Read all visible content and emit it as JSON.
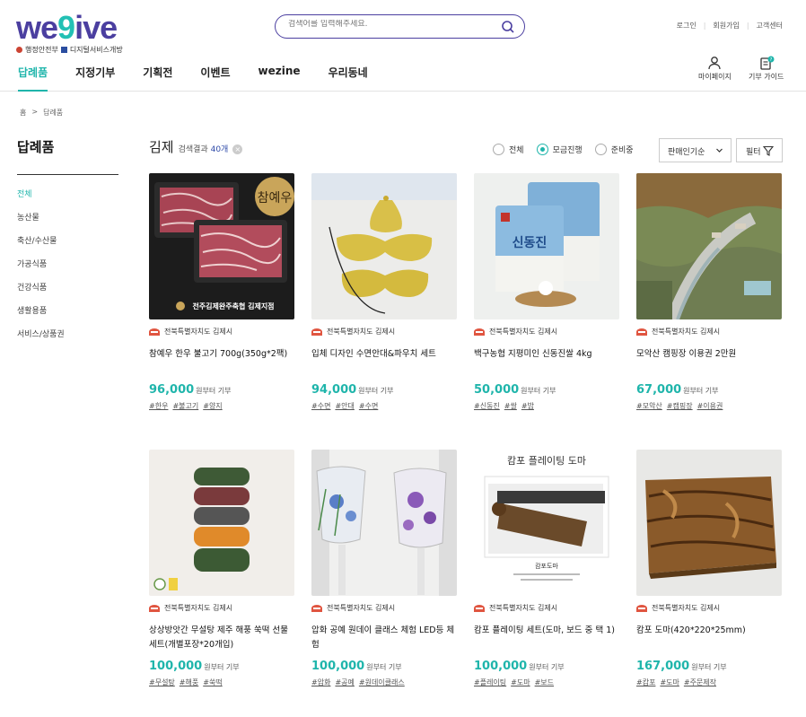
{
  "header": {
    "logo_main": "we",
    "logo_mid": "9",
    "logo_tail": "ive",
    "logo_org1": "행정안전부",
    "logo_org2": "디지털서비스개방",
    "search_placeholder": "검색어를 입력해주세요.",
    "util_links": [
      "로그인",
      "회원가입",
      "고객센터"
    ],
    "nav": [
      "답례품",
      "지정기부",
      "기획전",
      "이벤트",
      "wezine",
      "우리동네"
    ],
    "mypage_label": "마이페이지",
    "guide_label": "기부 가이드",
    "guide_badge": "?"
  },
  "breadcrumb": [
    "홈",
    ">",
    "답례품"
  ],
  "sidebar": {
    "title": "답례품",
    "items": [
      "전체",
      "농산물",
      "축산/수산물",
      "가공식품",
      "건강식품",
      "생활용품",
      "서비스/상품권"
    ]
  },
  "results": {
    "keyword": "김제",
    "label": "검색결과",
    "count": "40개",
    "clear": "×"
  },
  "filters": {
    "options": [
      "전체",
      "모금진행",
      "준비중"
    ],
    "selected": "모금진행",
    "sort_value": "판매인기순",
    "filter_label": "필터"
  },
  "colors": {
    "accent": "#1fb5ab",
    "brand": "#4b3fa0",
    "count": "#2e4aa8"
  },
  "products": [
    {
      "seller": "전북특별자치도 김제시",
      "name": "참예우 한우 불고기 700g(350g*2팩)",
      "price": "96,000",
      "price_unit": "원부터 기부",
      "tags": [
        "#한우",
        "#불고기",
        "#양지"
      ],
      "image_text": "참예우",
      "image_caption": "전주김제완주축협 김제지점"
    },
    {
      "seller": "전북특별자치도 김제시",
      "name": "입체 디자인 수면안대&파우치 세트",
      "price": "94,000",
      "price_unit": "원부터 기부",
      "tags": [
        "#수면",
        "#안대",
        "#수면"
      ]
    },
    {
      "seller": "전북특별자치도 김제시",
      "name": "백구농협 지평미인 신동진쌀 4kg",
      "price": "50,000",
      "price_unit": "원부터 기부",
      "tags": [
        "#신동진",
        "#쌀",
        "#밥"
      ],
      "image_text": "신동진"
    },
    {
      "seller": "전북특별자치도 김제시",
      "name": "모악산 캠핑장 이용권 2만원",
      "price": "67,000",
      "price_unit": "원부터 기부",
      "tags": [
        "#모악산",
        "#캠핑장",
        "#이용권"
      ]
    },
    {
      "seller": "전북특별자치도 김제시",
      "name": "상상방앗간 무설탕 제주 해풍 쑥떡 선물세트(개별포장*20개입)",
      "price": "100,000",
      "price_unit": "원부터 기부",
      "tags": [
        "#무설탕",
        "#해풍",
        "#쑥떡"
      ]
    },
    {
      "seller": "전북특별자치도 김제시",
      "name": "압화 공예 원데이 클래스 체험 LED등 체험",
      "price": "100,000",
      "price_unit": "원부터 기부",
      "tags": [
        "#압화",
        "#공예",
        "#원데이클래스"
      ]
    },
    {
      "seller": "전북특별자치도 김제시",
      "name": "캄포 플레이팅 세트(도마, 보드 중 택 1)",
      "price": "100,000",
      "price_unit": "원부터 기부",
      "tags": [
        "#플레이팅",
        "#도마",
        "#보드"
      ],
      "image_text": "캄포 플레이팅 도마",
      "image_caption": "캄포도마"
    },
    {
      "seller": "전북특별자치도 김제시",
      "name": "캄포 도마(420*220*25mm)",
      "price": "167,000",
      "price_unit": "원부터 기부",
      "tags": [
        "#캄포",
        "#도마",
        "#주문제작"
      ]
    }
  ]
}
